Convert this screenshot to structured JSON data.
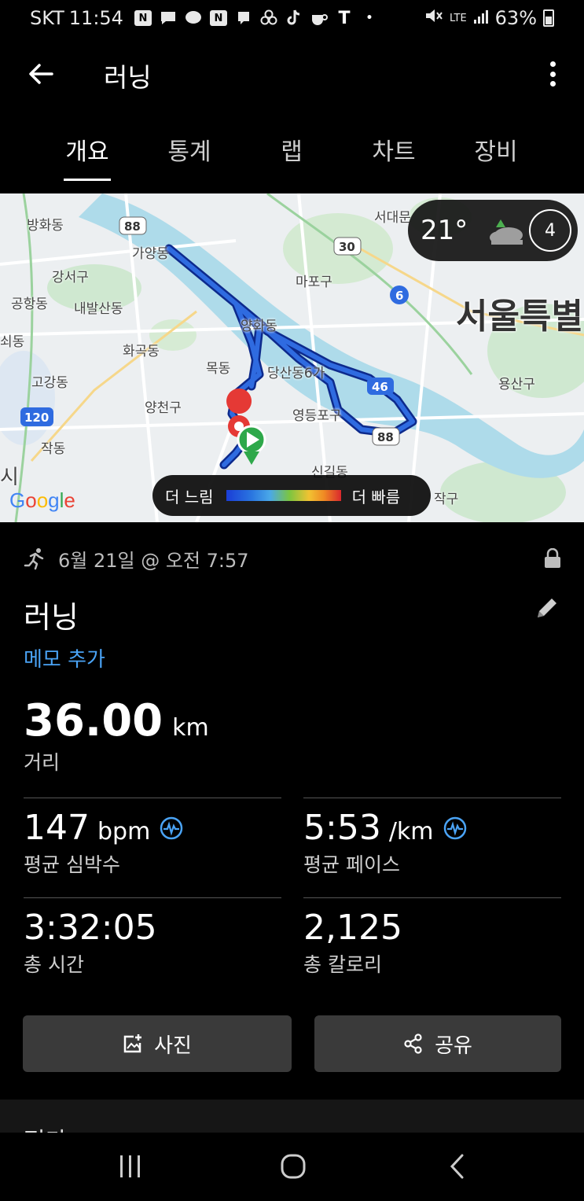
{
  "status_bar": {
    "carrier": "SKT",
    "time": "11:54",
    "network": "LTE",
    "battery": "63%"
  },
  "header": {
    "title": "러닝"
  },
  "tabs": [
    {
      "label": "개요",
      "active": true
    },
    {
      "label": "통계",
      "active": false
    },
    {
      "label": "랩",
      "active": false
    },
    {
      "label": "차트",
      "active": false
    },
    {
      "label": "장비",
      "active": false
    }
  ],
  "map": {
    "labels": [
      "방화동",
      "가양동",
      "강서구",
      "공항동",
      "내발산동",
      "화곡동",
      "목동",
      "양화동",
      "당산동6가",
      "양천구",
      "영등포구",
      "고강동",
      "작동",
      "마포구",
      "서대문",
      "서울특별",
      "용산구",
      "신길동",
      "작구",
      "쇠동",
      "시"
    ],
    "road_shields": [
      "88",
      "30",
      "6",
      "46",
      "88",
      "120"
    ],
    "weather": {
      "temperature": "21°",
      "uv_index": "4"
    },
    "attribution": "Google",
    "pace_legend": {
      "slow_label": "더 느림",
      "fast_label": "더 빠름"
    }
  },
  "summary": {
    "date_time": "6월 21일 @ 오전 7:57",
    "activity_name": "러닝",
    "memo_link": "메모 추가",
    "distance": {
      "value": "36.00",
      "unit": "km",
      "label": "거리"
    },
    "heart_rate": {
      "value": "147",
      "unit": "bpm",
      "label": "평균 심박수"
    },
    "pace": {
      "value": "5:53",
      "unit": "/km",
      "label": "평균 페이스"
    },
    "total_time": {
      "value": "3:32:05",
      "label": "총 시간"
    },
    "calories": {
      "value": "2,125",
      "label": "총 칼로리"
    }
  },
  "buttons": {
    "photo": "사진",
    "share": "공유"
  },
  "next_section_title": "평가",
  "colors": {
    "accent_link": "#4aa3f5",
    "route": "#1b4fd1",
    "button_bg": "#3a3a3a"
  }
}
